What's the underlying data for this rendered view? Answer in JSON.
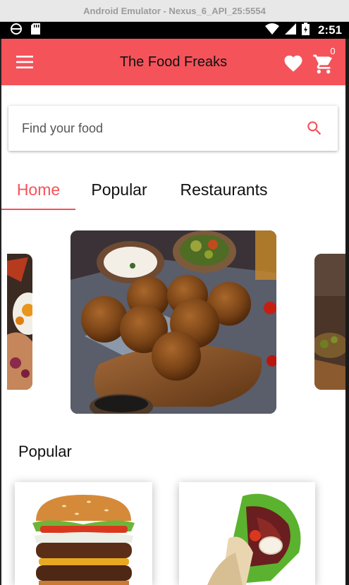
{
  "emulator": {
    "title": "Android Emulator - Nexus_6_API_25:5554"
  },
  "status_bar": {
    "time": "2:51"
  },
  "app_bar": {
    "title": "The Food Freaks",
    "cart_count": "0"
  },
  "search": {
    "placeholder": "Find your food",
    "value": ""
  },
  "tabs": [
    {
      "label": "Home",
      "active": true
    },
    {
      "label": "Popular",
      "active": false
    },
    {
      "label": "Restaurants",
      "active": false
    }
  ],
  "sections": {
    "popular_title": "Popular"
  },
  "colors": {
    "accent": "#f4535a",
    "status_bar": "#000000"
  },
  "icons": [
    "menu-icon",
    "heart-icon",
    "cart-icon",
    "search-icon"
  ]
}
